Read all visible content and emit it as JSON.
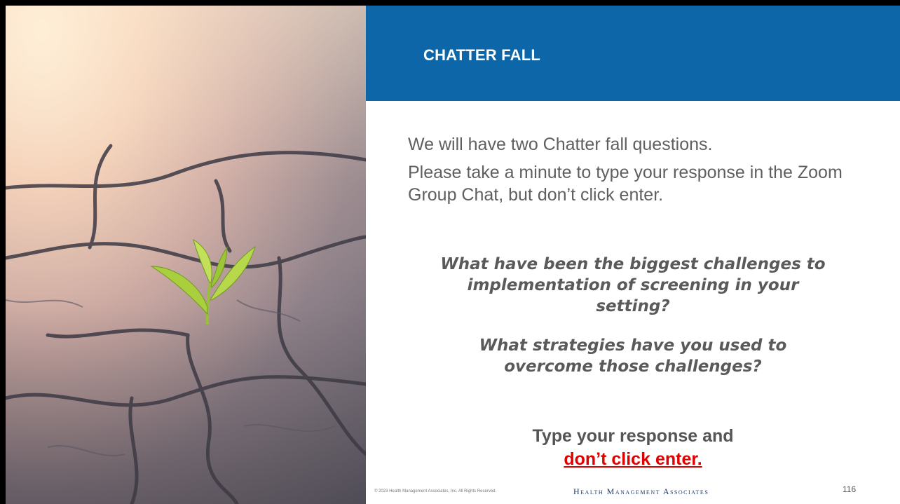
{
  "slide": {
    "title": "CHATTER FALL",
    "intro_line1": "We will have two Chatter fall questions.",
    "intro_line2": "Please take a minute to type your response in the Zoom Group Chat, but  don’t click enter.",
    "question1": "What have been the biggest challenges to implementation of screening in your setting?",
    "question2": "What strategies have you used to overcome those challenges?",
    "cta_line1": "Type your response and",
    "cta_line2": "don’t click enter.",
    "footer_copyright": "© 2023 Health Management Associates, Inc. All Rights Reserved.",
    "footer_brand": "Health Management Associates",
    "page_number": "116"
  },
  "image": {
    "icon": "sprout-in-cracked-ground-image"
  },
  "colors": {
    "header": "#0d66a8",
    "emphasis_red": "#e00000",
    "body_text": "#5f5f5f"
  }
}
